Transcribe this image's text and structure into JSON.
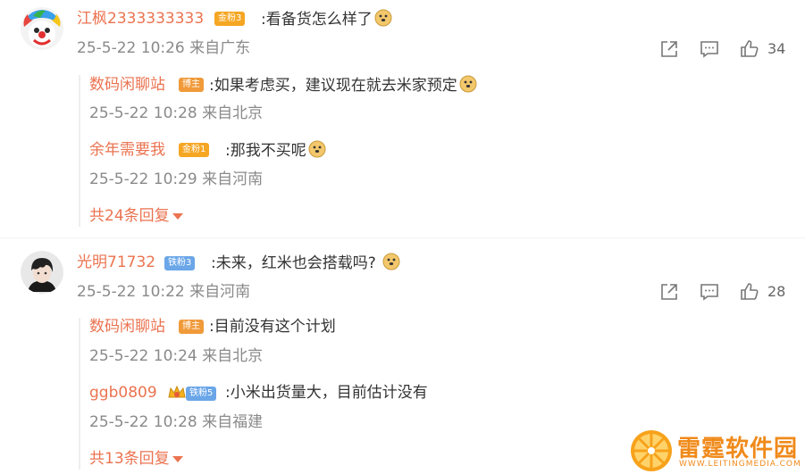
{
  "comments": [
    {
      "username": "江枫2333333333",
      "badge": "金粉3",
      "text": ":看备货怎么样了",
      "time": "25-5-22 10:26",
      "location": "来自广东",
      "likes": "34",
      "avatar_icon": "clown-avatar",
      "replies": [
        {
          "username": "数码闲聊站",
          "badge": "博主",
          "text": ":如果考虑买，建议现在就去米家预定",
          "time": "25-5-22 10:28",
          "location": "来自北京"
        },
        {
          "username": "余年需要我",
          "badge": "金粉1",
          "text": ":那我不买呢",
          "time": "25-5-22 10:29",
          "location": "来自河南"
        }
      ],
      "more_replies": "共24条回复"
    },
    {
      "username": "光明71732",
      "badge": "铁粉3",
      "text": ":未来，红米也会搭载吗?",
      "time": "25-5-22 10:22",
      "location": "来自河南",
      "likes": "28",
      "avatar_icon": "anime-boy-avatar",
      "replies": [
        {
          "username": "数码闲聊站",
          "badge": "博主",
          "text": ":目前没有这个计划",
          "time": "25-5-22 10:24",
          "location": "来自北京"
        },
        {
          "username": "ggb0809",
          "badge": "铁粉5",
          "text": ":小米出货量大，目前估计没有",
          "time": "25-5-22 10:28",
          "location": "来自福建"
        }
      ],
      "more_replies": "共13条回复"
    }
  ],
  "watermark": {
    "name": "雷霆软件园",
    "url": "WWW.LEITINGMEDIA.COM"
  },
  "colors": {
    "username": "#eb7350",
    "meta": "#8a8a8a",
    "text": "#333333"
  }
}
